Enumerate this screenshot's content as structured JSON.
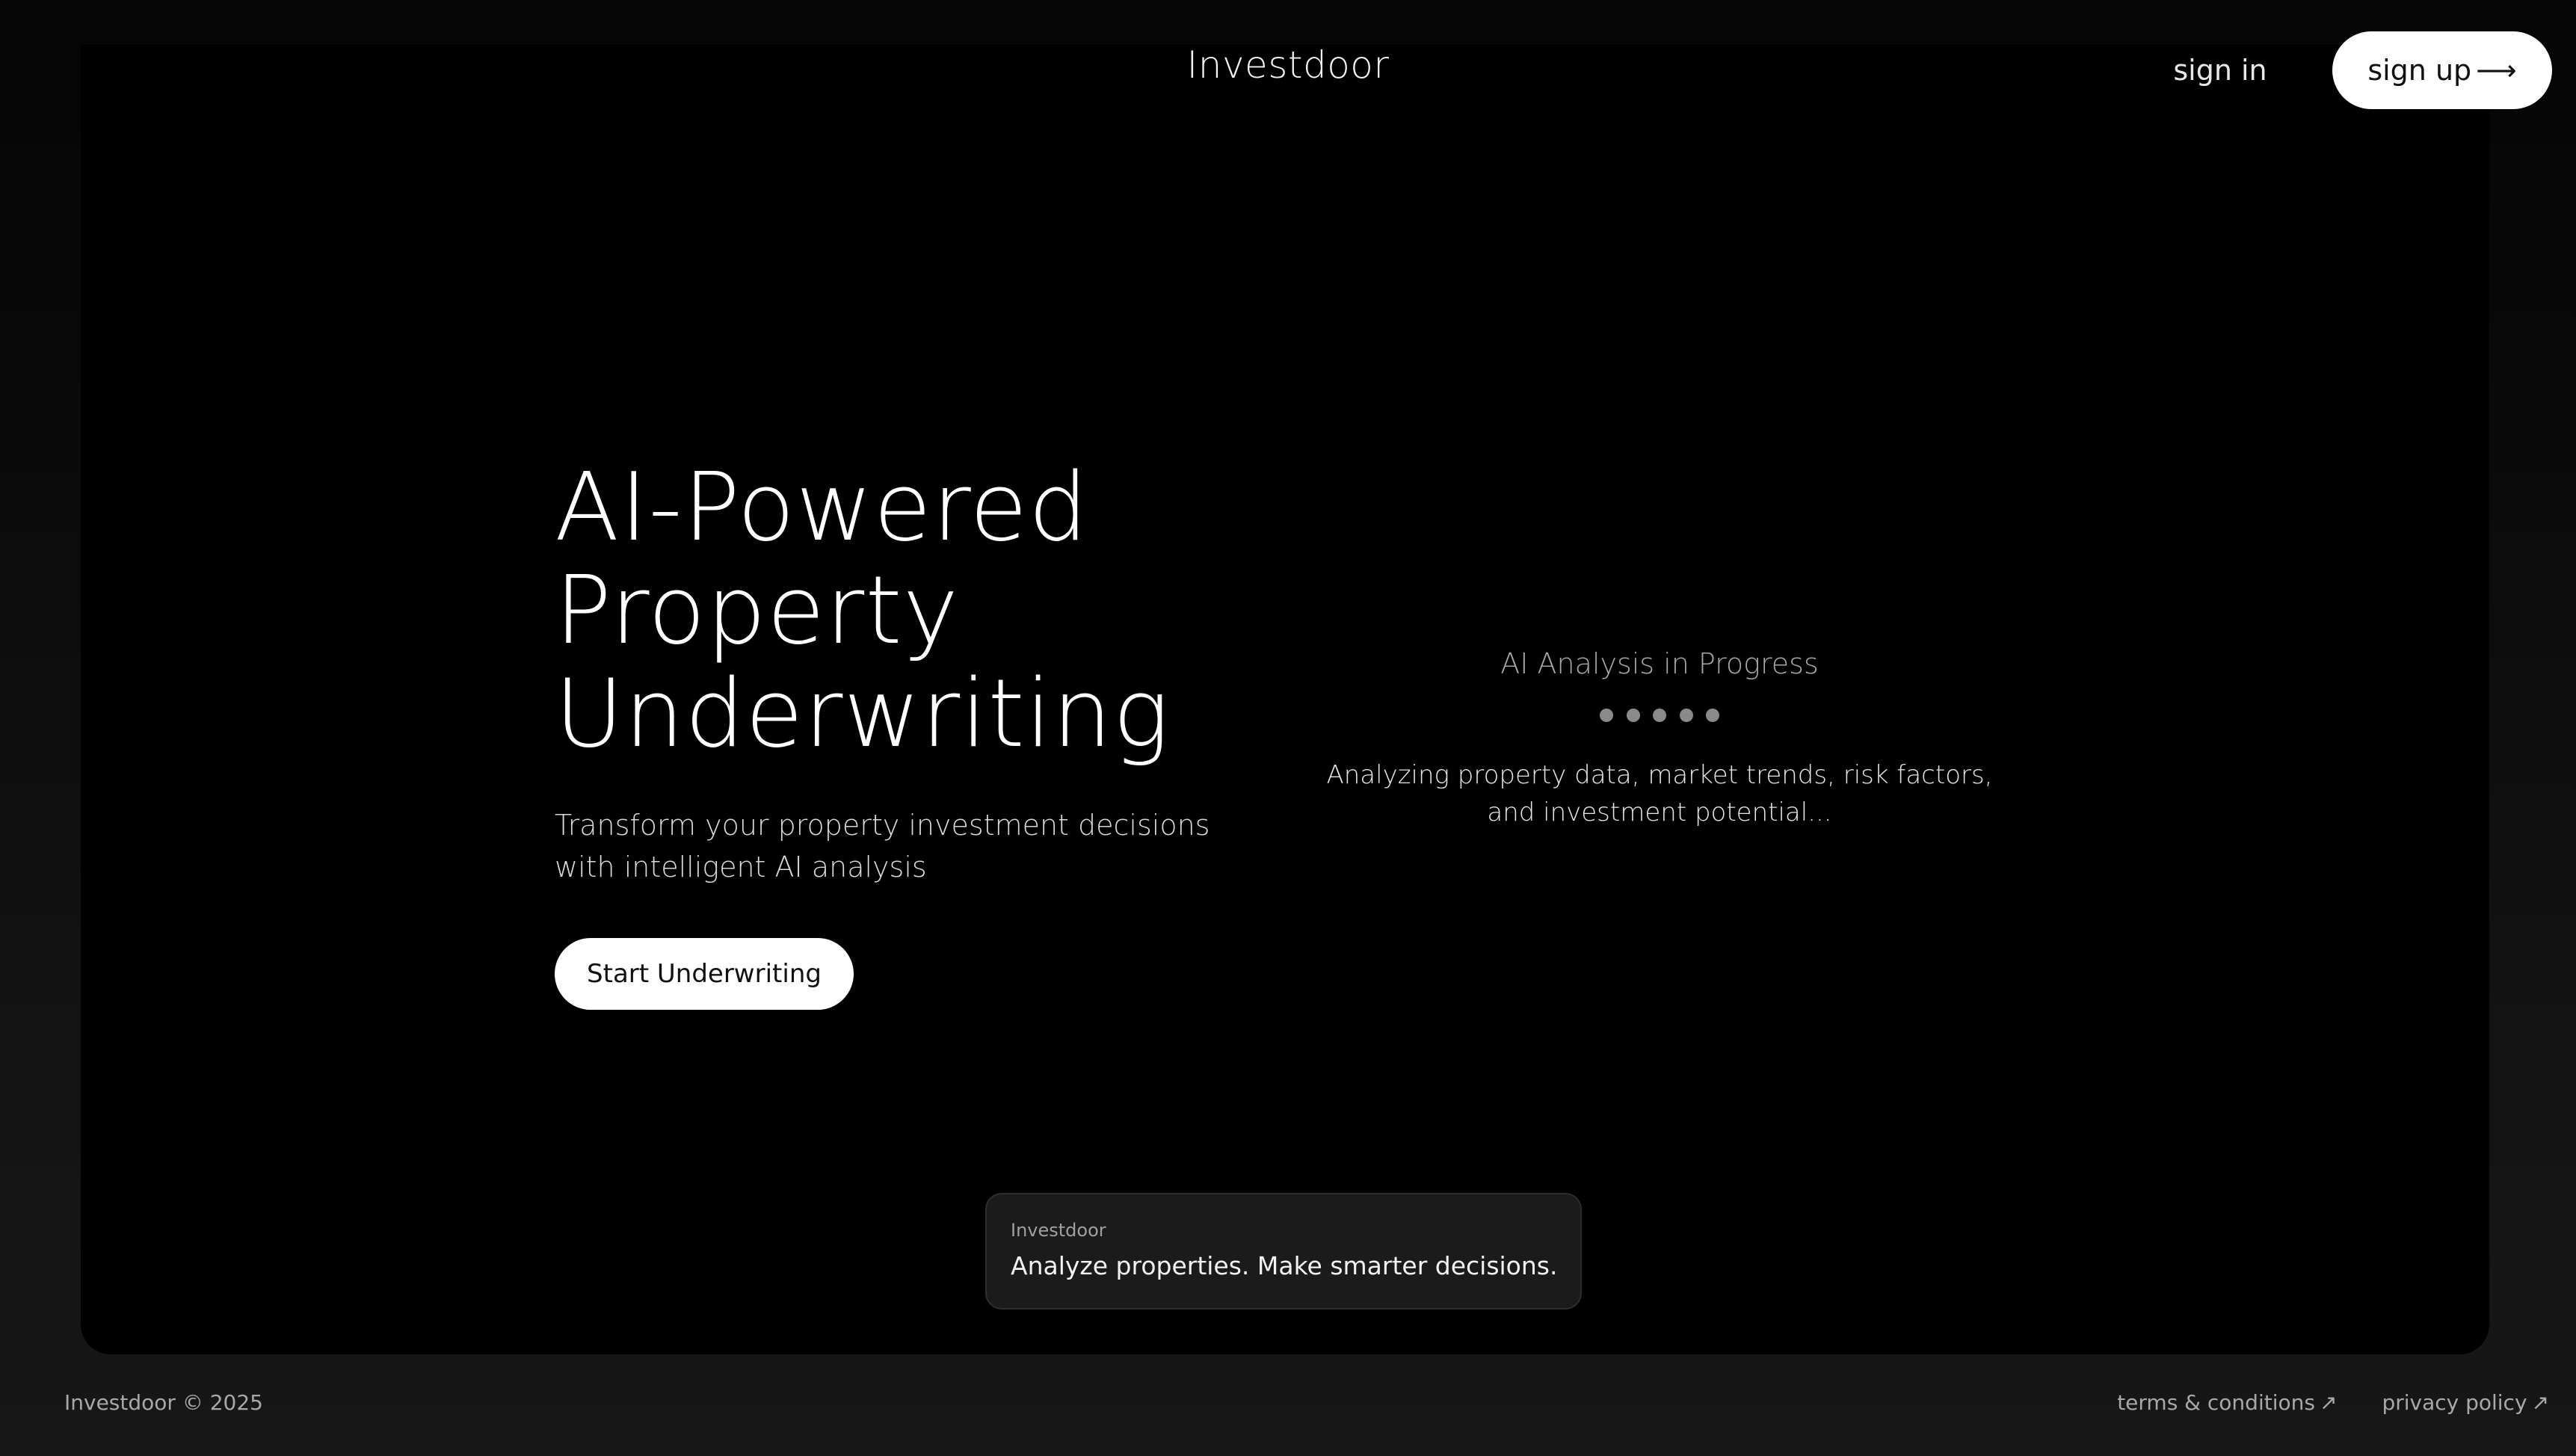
{
  "header": {
    "brand": "Investdoor",
    "signin_label": "sign in",
    "signup_label": "sign up",
    "signup_arrow": "⟶"
  },
  "hero": {
    "title_lines": [
      "AI-Powered",
      "Property",
      "Underwriting"
    ],
    "subtitle": "Transform your property investment decisions with intelligent AI analysis",
    "cta_label": "Start Underwriting"
  },
  "analysis": {
    "title": "AI Analysis in Progress",
    "description": "Analyzing property data, market trends, risk factors, and investment potential..."
  },
  "tagline_card": {
    "brand": "Investdoor",
    "text": "Analyze properties. Make smarter decisions."
  },
  "footer": {
    "copyright": "Investdoor © 2025",
    "links": [
      {
        "label": "terms & conditions",
        "icon": "↗"
      },
      {
        "label": "privacy policy",
        "icon": "↗"
      }
    ]
  },
  "colors": {
    "background": "#000000",
    "accent": "#ffffff",
    "muted_text": "#a8a8a8"
  }
}
